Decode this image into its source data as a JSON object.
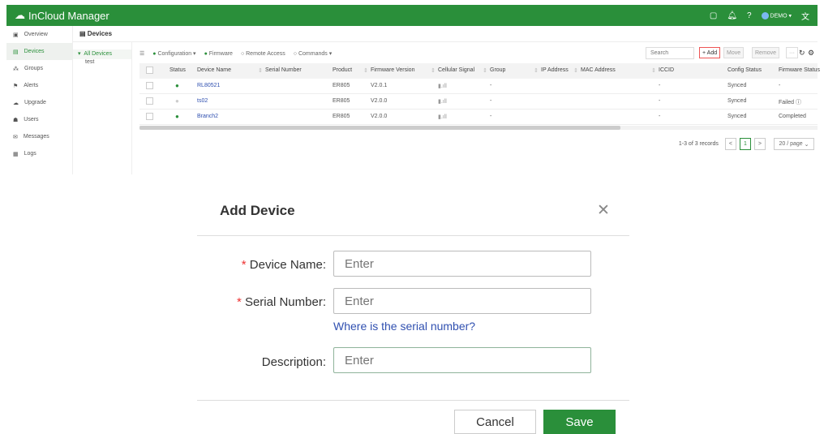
{
  "app": {
    "title": "InCloud Manager",
    "user": "DEMO"
  },
  "sidebar": {
    "items": [
      {
        "label": "Overview",
        "icon": "▣"
      },
      {
        "label": "Devices",
        "icon": "▤",
        "active": true
      },
      {
        "label": "Groups",
        "icon": "⁂"
      },
      {
        "label": "Alerts",
        "icon": "⚑"
      },
      {
        "label": "Upgrade",
        "icon": "☁"
      },
      {
        "label": "Users",
        "icon": "☗"
      },
      {
        "label": "Messages",
        "icon": "✉"
      },
      {
        "label": "Logs",
        "icon": "▦"
      }
    ]
  },
  "breadcrumb": "Devices",
  "tree": {
    "root": "All Devices",
    "children": [
      "test"
    ]
  },
  "toolbar": {
    "configuration": "Configuration",
    "firmware": "Firmware",
    "remote_access": "Remote Access",
    "commands": "Commands",
    "search_placeholder": "Search",
    "add": "+ Add",
    "move": "Move",
    "remove": "Remove",
    "more": "···"
  },
  "table": {
    "columns": [
      "Status",
      "Device Name",
      "Serial Number",
      "Product",
      "Firmware Version",
      "Cellular Signal",
      "Group",
      "IP Address",
      "MAC Address",
      "ICCID",
      "Config Status",
      "Firmware Status"
    ],
    "rows": [
      {
        "status": "online",
        "name": "RL80521",
        "serial": "",
        "product": "ER805",
        "firmware": "V2.0.1",
        "signal": "▮.ıll",
        "group": "-",
        "ip": "",
        "mac": "",
        "iccid": "-",
        "config": "Synced",
        "fw_status": "-"
      },
      {
        "status": "offline",
        "name": "ts02",
        "serial": "",
        "product": "ER805",
        "firmware": "V2.0.0",
        "signal": "▮.ıll",
        "group": "-",
        "ip": "",
        "mac": "",
        "iccid": "-",
        "config": "Synced",
        "fw_status": "Failed ⓘ"
      },
      {
        "status": "online",
        "name": "Branch2",
        "serial": "",
        "product": "ER805",
        "firmware": "V2.0.0",
        "signal": "▮.ıll",
        "group": "-",
        "ip": "",
        "mac": "",
        "iccid": "-",
        "config": "Synced",
        "fw_status": "Completed"
      }
    ]
  },
  "pagination": {
    "summary": "1-3 of 3 records",
    "prev": "<",
    "page": "1",
    "next": ">",
    "page_size": "20 / page"
  },
  "dialog": {
    "title": "Add Device",
    "close": "✕",
    "device_name_label": "Device Name:",
    "serial_label": "Serial Number:",
    "description_label": "Description:",
    "placeholder": "Enter",
    "serial_help": "Where is the serial number?",
    "cancel": "Cancel",
    "save": "Save",
    "required_mark": "*"
  },
  "colors": {
    "brand": "#2a8f3a",
    "link": "#3050b0"
  }
}
